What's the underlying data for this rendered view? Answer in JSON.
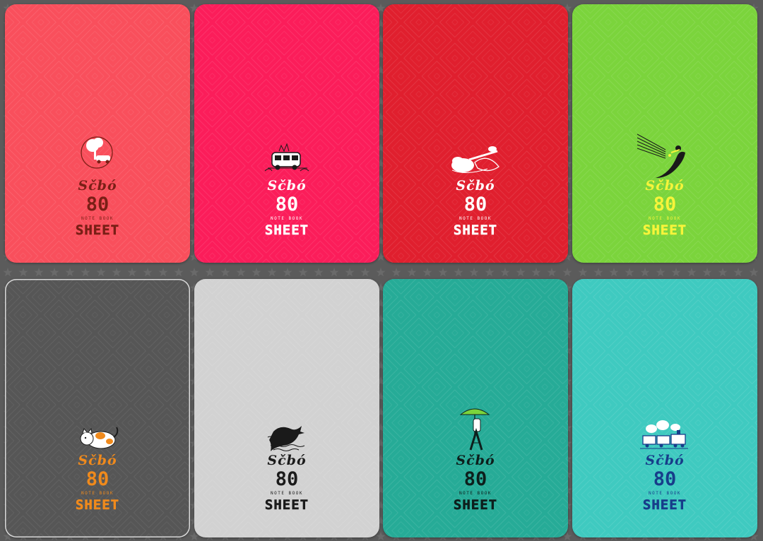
{
  "cards": [
    {
      "brand": "Sčbó",
      "number": "80",
      "subtitle": "NOTE BOOK",
      "sheet": "SHEET",
      "bg": "#f94f5c",
      "fg": "#7a1f16",
      "icon": "tree-car-illustration-icon"
    },
    {
      "brand": "Sčbó",
      "number": "80",
      "subtitle": "NOTE BOOK",
      "sheet": "SHEET",
      "bg": "#fb1d5a",
      "fg": "#ffffff",
      "icon": "camper-van-illustration-icon"
    },
    {
      "brand": "Sčbó",
      "number": "80",
      "subtitle": "NOTE BOOK",
      "sheet": "SHEET",
      "bg": "#e01f2e",
      "fg": "#ffffff",
      "icon": "guitar-cloud-illustration-icon"
    },
    {
      "brand": "Sčbó",
      "number": "80",
      "subtitle": "NOTE BOOK",
      "sheet": "SHEET",
      "bg": "#7bd43c",
      "fg": "#f6f43a",
      "icon": "musician-staff-illustration-icon"
    },
    {
      "brand": "Sčbó",
      "number": "80",
      "subtitle": "NOTE BOOK",
      "sheet": "SHEET",
      "bg": "#565656",
      "fg": "#f08a1c",
      "icon": "cat-illustration-icon"
    },
    {
      "brand": "Sčbó",
      "number": "80",
      "subtitle": "NOTE BOOK",
      "sheet": "SHEET",
      "bg": "#d2d2d2",
      "fg": "#1b1b1b",
      "icon": "whale-illustration-icon"
    },
    {
      "brand": "Sčbó",
      "number": "80",
      "subtitle": "NOTE BOOK",
      "sheet": "SHEET",
      "bg": "#26ab97",
      "fg": "#0d1f1c",
      "icon": "umbrella-figure-illustration-icon"
    },
    {
      "brand": "Sčbó",
      "number": "80",
      "subtitle": "NOTE BOOK",
      "sheet": "SHEET",
      "bg": "#3fcac0",
      "fg": "#173d8a",
      "icon": "steam-train-illustration-icon"
    }
  ]
}
